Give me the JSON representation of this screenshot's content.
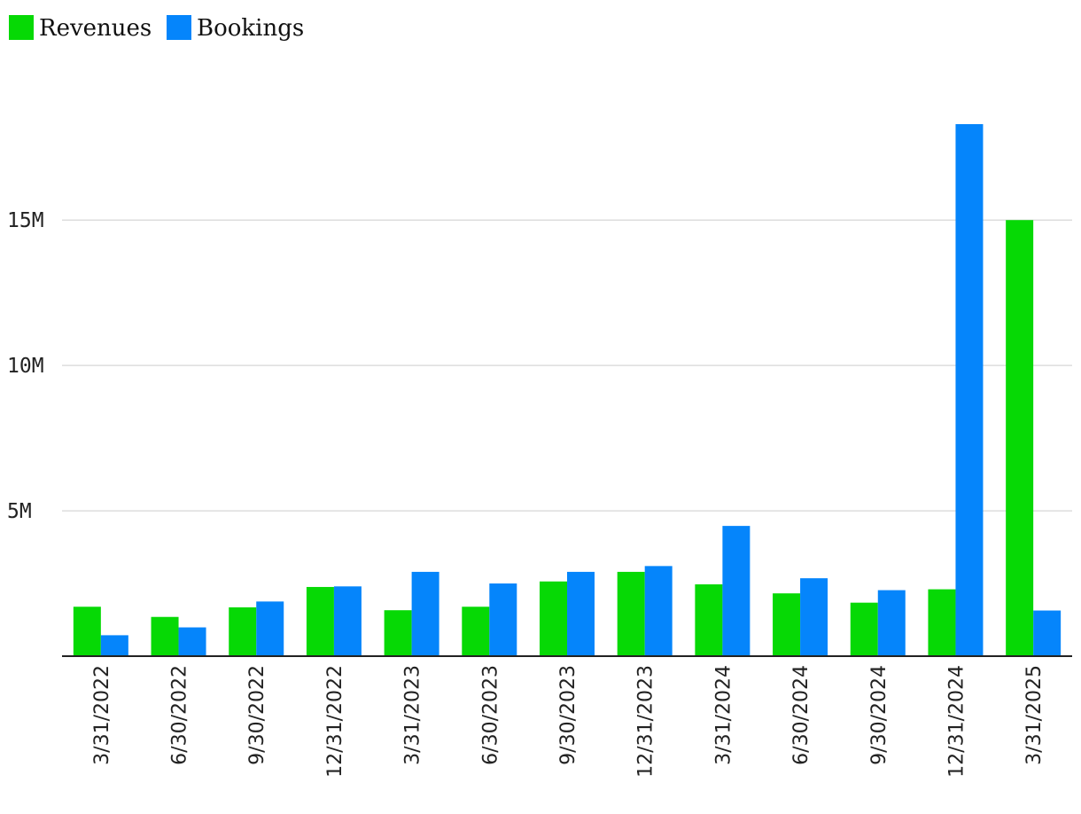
{
  "chart_data": {
    "type": "bar",
    "categories": [
      "3/31/2022",
      "6/30/2022",
      "9/30/2022",
      "12/31/2022",
      "3/31/2023",
      "6/30/2023",
      "9/30/2023",
      "12/31/2023",
      "3/31/2024",
      "6/30/2024",
      "9/30/2024",
      "12/31/2024",
      "3/31/2025"
    ],
    "series": [
      {
        "name": "Revenues",
        "color": "#06d905",
        "values": [
          1700000,
          1350000,
          1680000,
          2380000,
          1580000,
          1700000,
          2570000,
          2900000,
          2470000,
          2160000,
          1840000,
          2300000,
          15000000
        ]
      },
      {
        "name": "Bookings",
        "color": "#0585fb",
        "values": [
          720000,
          990000,
          1880000,
          2400000,
          2900000,
          2500000,
          2900000,
          3100000,
          4480000,
          2680000,
          2270000,
          18300000,
          1570000
        ]
      }
    ],
    "y_ticks": [
      {
        "value": 5000000,
        "label": "5M"
      },
      {
        "value": 10000000,
        "label": "10M"
      },
      {
        "value": 15000000,
        "label": "15M"
      }
    ],
    "ylim": [
      0,
      18300000
    ],
    "grid": true,
    "legend_position": "top-left",
    "title": "",
    "xlabel": "",
    "ylabel": ""
  }
}
